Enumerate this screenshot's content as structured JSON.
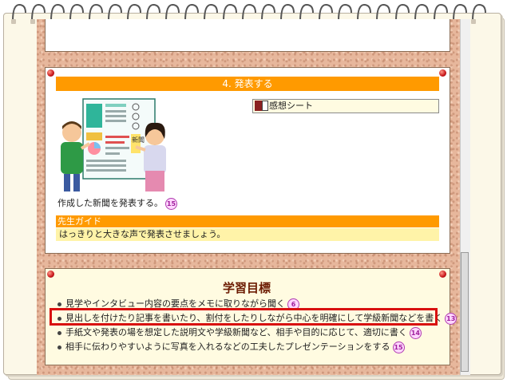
{
  "section_title": "4. 発表する",
  "sheet_link": {
    "label": "感想シート"
  },
  "illustration": {
    "poster_heading": "新聞"
  },
  "caption": {
    "text": "作成した新聞を発表する。",
    "badge": "15"
  },
  "guide": {
    "title": "先生ガイド",
    "text": "はっきりと大きな声で発表させましょう。"
  },
  "goals": {
    "title": "学習目標",
    "items": [
      {
        "text": "見学やインタビュー内容の要点をメモに取りながら聞く",
        "badge": "6"
      },
      {
        "text": "見出しを付けたり記事を書いたり、割付をしたりしながら中心を明確にして学級新聞などを書く",
        "badge": "13"
      },
      {
        "text": "手紙文や発表の場を想定した説明文や学級新聞など、相手や目的に応じて、適切に書く",
        "badge": "14"
      },
      {
        "text": "相手に伝わりやすいように写真を入れるなどの工夫したプレゼンテーションをする",
        "badge": "15"
      }
    ]
  },
  "colors": {
    "accent": "#ff9a00",
    "highlight": "#d81010",
    "badge": "#a0209c",
    "cork": "#e7b79c"
  }
}
